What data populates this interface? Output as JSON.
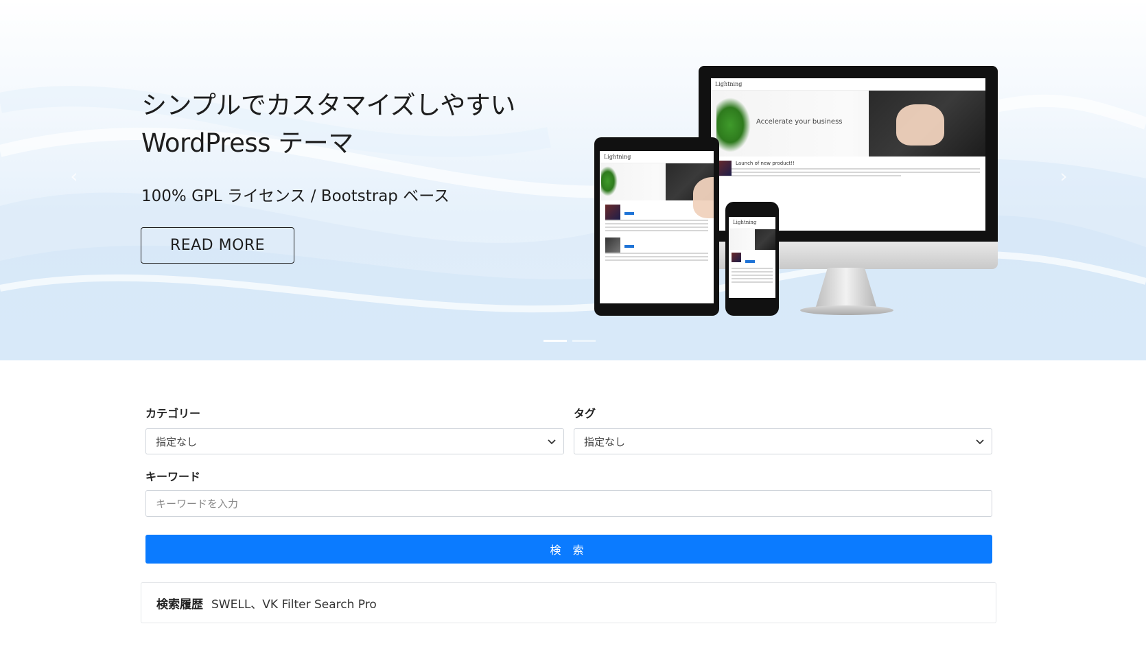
{
  "hero": {
    "title_line1": "シンプルでカスタマイズしやすい",
    "title_line2": "WordPress テーマ",
    "subtitle": "100% GPL ライセンス / Bootstrap ベース",
    "read_more_label": "READ MORE",
    "prev_icon": "chevron-left-icon",
    "next_icon": "chevron-right-icon",
    "slide_count": 2,
    "active_slide": 1
  },
  "devices": {
    "monitor_brand": "Lightning",
    "monitor_tagline": "Accelerate your business",
    "tablet_brand": "Lightning",
    "phone_brand": "Lightning",
    "post_title": "Launch of new product!!"
  },
  "filter": {
    "category_label": "カテゴリー",
    "category_value": "指定なし",
    "tag_label": "タグ",
    "tag_value": "指定なし",
    "keyword_label": "キーワード",
    "keyword_placeholder": "キーワードを入力",
    "search_label": "検 索"
  },
  "history": {
    "label": "検索履歴",
    "value": "SWELL、VK Filter Search Pro"
  },
  "colors": {
    "primary": "#0b7bff",
    "text": "#222222",
    "border": "#cfd4da"
  }
}
